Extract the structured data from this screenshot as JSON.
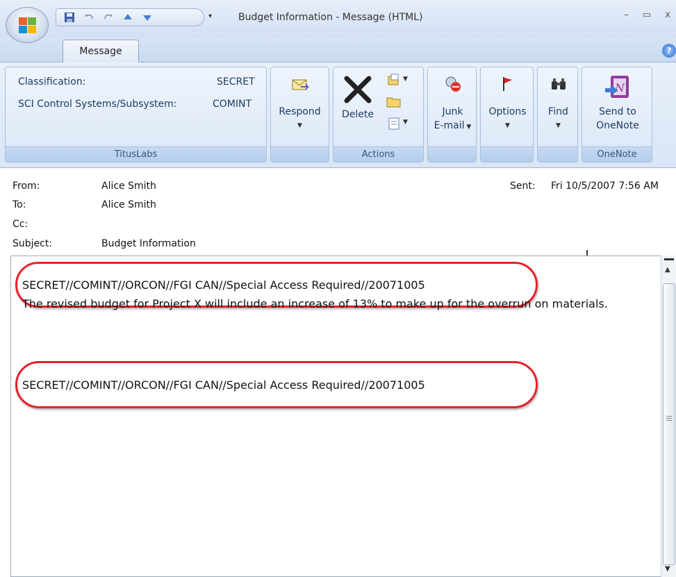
{
  "window": {
    "title": "Budget Information - Message (HTML)",
    "controls": "– ▭ x"
  },
  "tabs": [
    {
      "label": "Message",
      "active": true
    }
  ],
  "ribbon": {
    "tituslabs": {
      "classification_label": "Classification:",
      "classification_value": "SECRET",
      "sci_label": "SCI Control Systems/Subsystem:",
      "sci_value": "COMINT",
      "group_label": "TitusLabs"
    },
    "respond": {
      "label": "Respond"
    },
    "actions": {
      "delete_label": "Delete",
      "group_label": "Actions"
    },
    "junk": {
      "label_line1": "Junk",
      "label_line2": "E-mail"
    },
    "options": {
      "label": "Options"
    },
    "find": {
      "label": "Find"
    },
    "onenote": {
      "label_line1": "Send to",
      "label_line2": "OneNote",
      "group_label": "OneNote"
    }
  },
  "header": {
    "from_label": "From:",
    "from_value": "Alice Smith",
    "to_label": "To:",
    "to_value": "Alice Smith",
    "cc_label": "Cc:",
    "subject_label": "Subject:",
    "subject_value": "Budget Information",
    "sent_label": "Sent:",
    "sent_value": "Fri 10/5/2007 7:56 AM"
  },
  "body": {
    "marking_top": "SECRET//COMINT//ORCON//FGI CAN//Special Access Required//20071005",
    "message": "The revised budget for Project X will include an increase of 13% to make up for the overrun on materials.",
    "marking_bottom": "SECRET//COMINT//ORCON//FGI CAN//Special Access Required//20071005"
  },
  "colors": {
    "highlight_oval": "#e8202a",
    "ribbon_bg": "#dfeaf8"
  }
}
